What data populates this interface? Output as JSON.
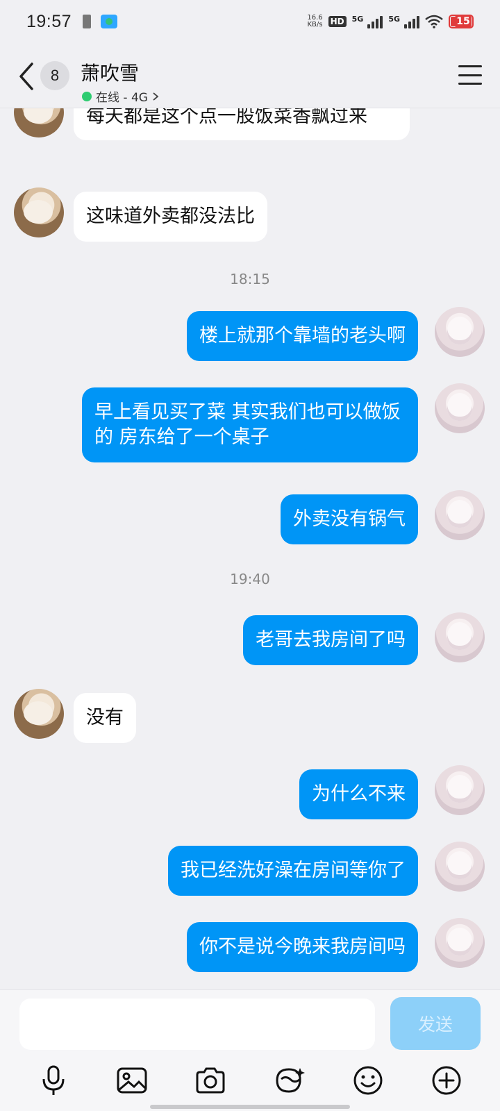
{
  "status_bar": {
    "time": "19:57",
    "net_speed_value": "16.6",
    "net_speed_unit": "KB/s",
    "hd_label": "HD",
    "sim1_label": "5G",
    "sim2_label": "5G",
    "battery_level": "15"
  },
  "header": {
    "unread_count": "8",
    "contact_name": "萧吹雪",
    "status_text": "在线 - 4G",
    "online_color": "#2ecc71"
  },
  "messages": [
    {
      "side": "in",
      "text": "每天都是这个点一股饭菜香飘过来"
    },
    {
      "side": "in",
      "text": "这味道外卖都没法比"
    },
    {
      "type": "time",
      "text": "18:15"
    },
    {
      "side": "out",
      "text": "楼上就那个靠墙的老头啊"
    },
    {
      "side": "out",
      "text": "早上看见买了菜 其实我们也可以做饭的 房东给了一个桌子"
    },
    {
      "side": "out",
      "text": "外卖没有锅气"
    },
    {
      "type": "time",
      "text": "19:40"
    },
    {
      "side": "out",
      "text": "老哥去我房间了吗"
    },
    {
      "side": "in",
      "text": "没有"
    },
    {
      "side": "out",
      "text": "为什么不来"
    },
    {
      "side": "out",
      "text": "我已经洗好澡在房间等你了"
    },
    {
      "side": "out",
      "text": "你不是说今晚来我房间吗"
    }
  ],
  "input": {
    "value": "",
    "send_label": "发送"
  },
  "toolbar_icons": [
    "microphone-icon",
    "image-icon",
    "camera-icon",
    "sticker-icon",
    "emoji-icon",
    "plus-icon"
  ],
  "colors": {
    "outgoing_bubble": "#0095f6",
    "incoming_bubble": "#ffffff",
    "send_button_disabled": "#8dd0f9"
  }
}
